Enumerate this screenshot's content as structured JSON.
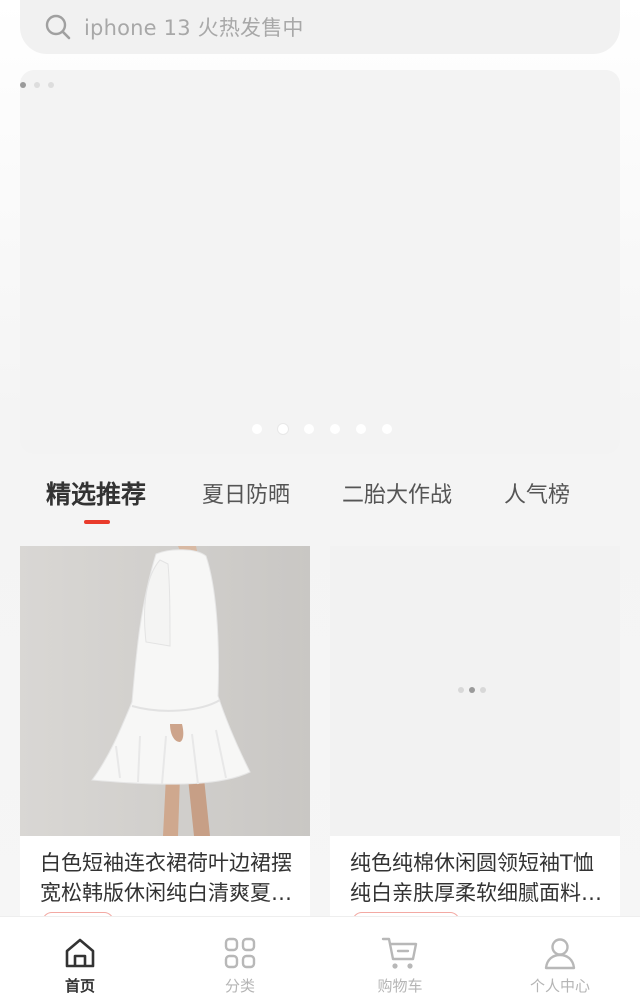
{
  "search": {
    "placeholder": "iphone 13 火热发售中",
    "icon": "search-icon"
  },
  "banner": {
    "dot_count": 6,
    "active_index": 1
  },
  "tabs": [
    {
      "label": "精选推荐",
      "active": true
    },
    {
      "label": "夏日防晒",
      "active": false
    },
    {
      "label": "二胎大作战",
      "active": false
    },
    {
      "label": "人气榜",
      "active": false
    }
  ],
  "products": [
    {
      "title": "白色短袖连衣裙荷叶边裙摆宽松韩版休闲纯白清爽夏季女装",
      "image": "white-dress-photo"
    },
    {
      "title": "纯色纯棉休闲圆领短袖T恤纯白亲肤厚柔软细腻面料纯白短袖套头T恤",
      "image": "loading-placeholder"
    }
  ],
  "nav": [
    {
      "label": "首页",
      "icon": "home-icon",
      "active": true
    },
    {
      "label": "分类",
      "icon": "category-grid-icon",
      "active": false
    },
    {
      "label": "购物车",
      "icon": "cart-icon",
      "active": false
    },
    {
      "label": "个人中心",
      "icon": "user-icon",
      "active": false
    }
  ],
  "colors": {
    "accent": "#e93b2b",
    "active_text": "#333333",
    "inactive_text": "#b5b5b5"
  }
}
